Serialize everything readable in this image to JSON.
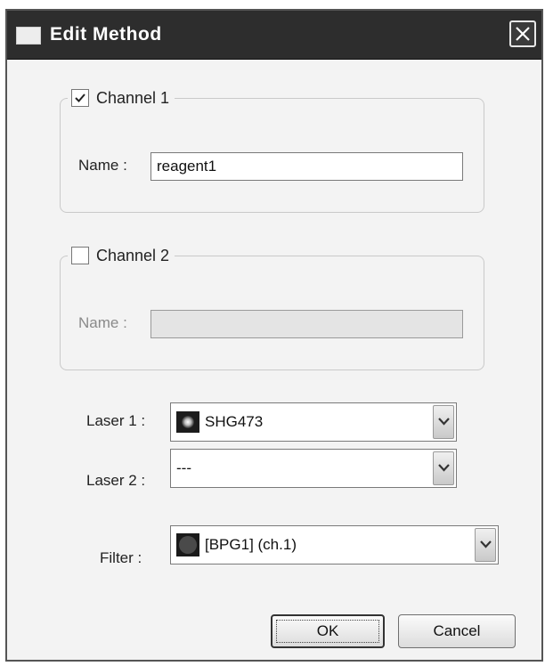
{
  "dialog": {
    "title": "Edit Method",
    "icons": {
      "close": "close-icon",
      "title": "window-icon"
    }
  },
  "channel1": {
    "label": "Channel 1",
    "checked": true,
    "name_label": "Name :",
    "name_value": "reagent1",
    "enabled": true
  },
  "channel2": {
    "label": "Channel 2",
    "checked": false,
    "name_label": "Name :",
    "name_value": "",
    "enabled": false
  },
  "laser1": {
    "label": "Laser 1 :",
    "value": "SHG473",
    "icon": "laser-icon"
  },
  "laser2": {
    "label": "Laser 2 :",
    "value": "---"
  },
  "filter": {
    "label": "Filter :",
    "value": "[BPG1] (ch.1)",
    "icon": "filter-icon"
  },
  "buttons": {
    "ok": "OK",
    "cancel": "Cancel"
  }
}
